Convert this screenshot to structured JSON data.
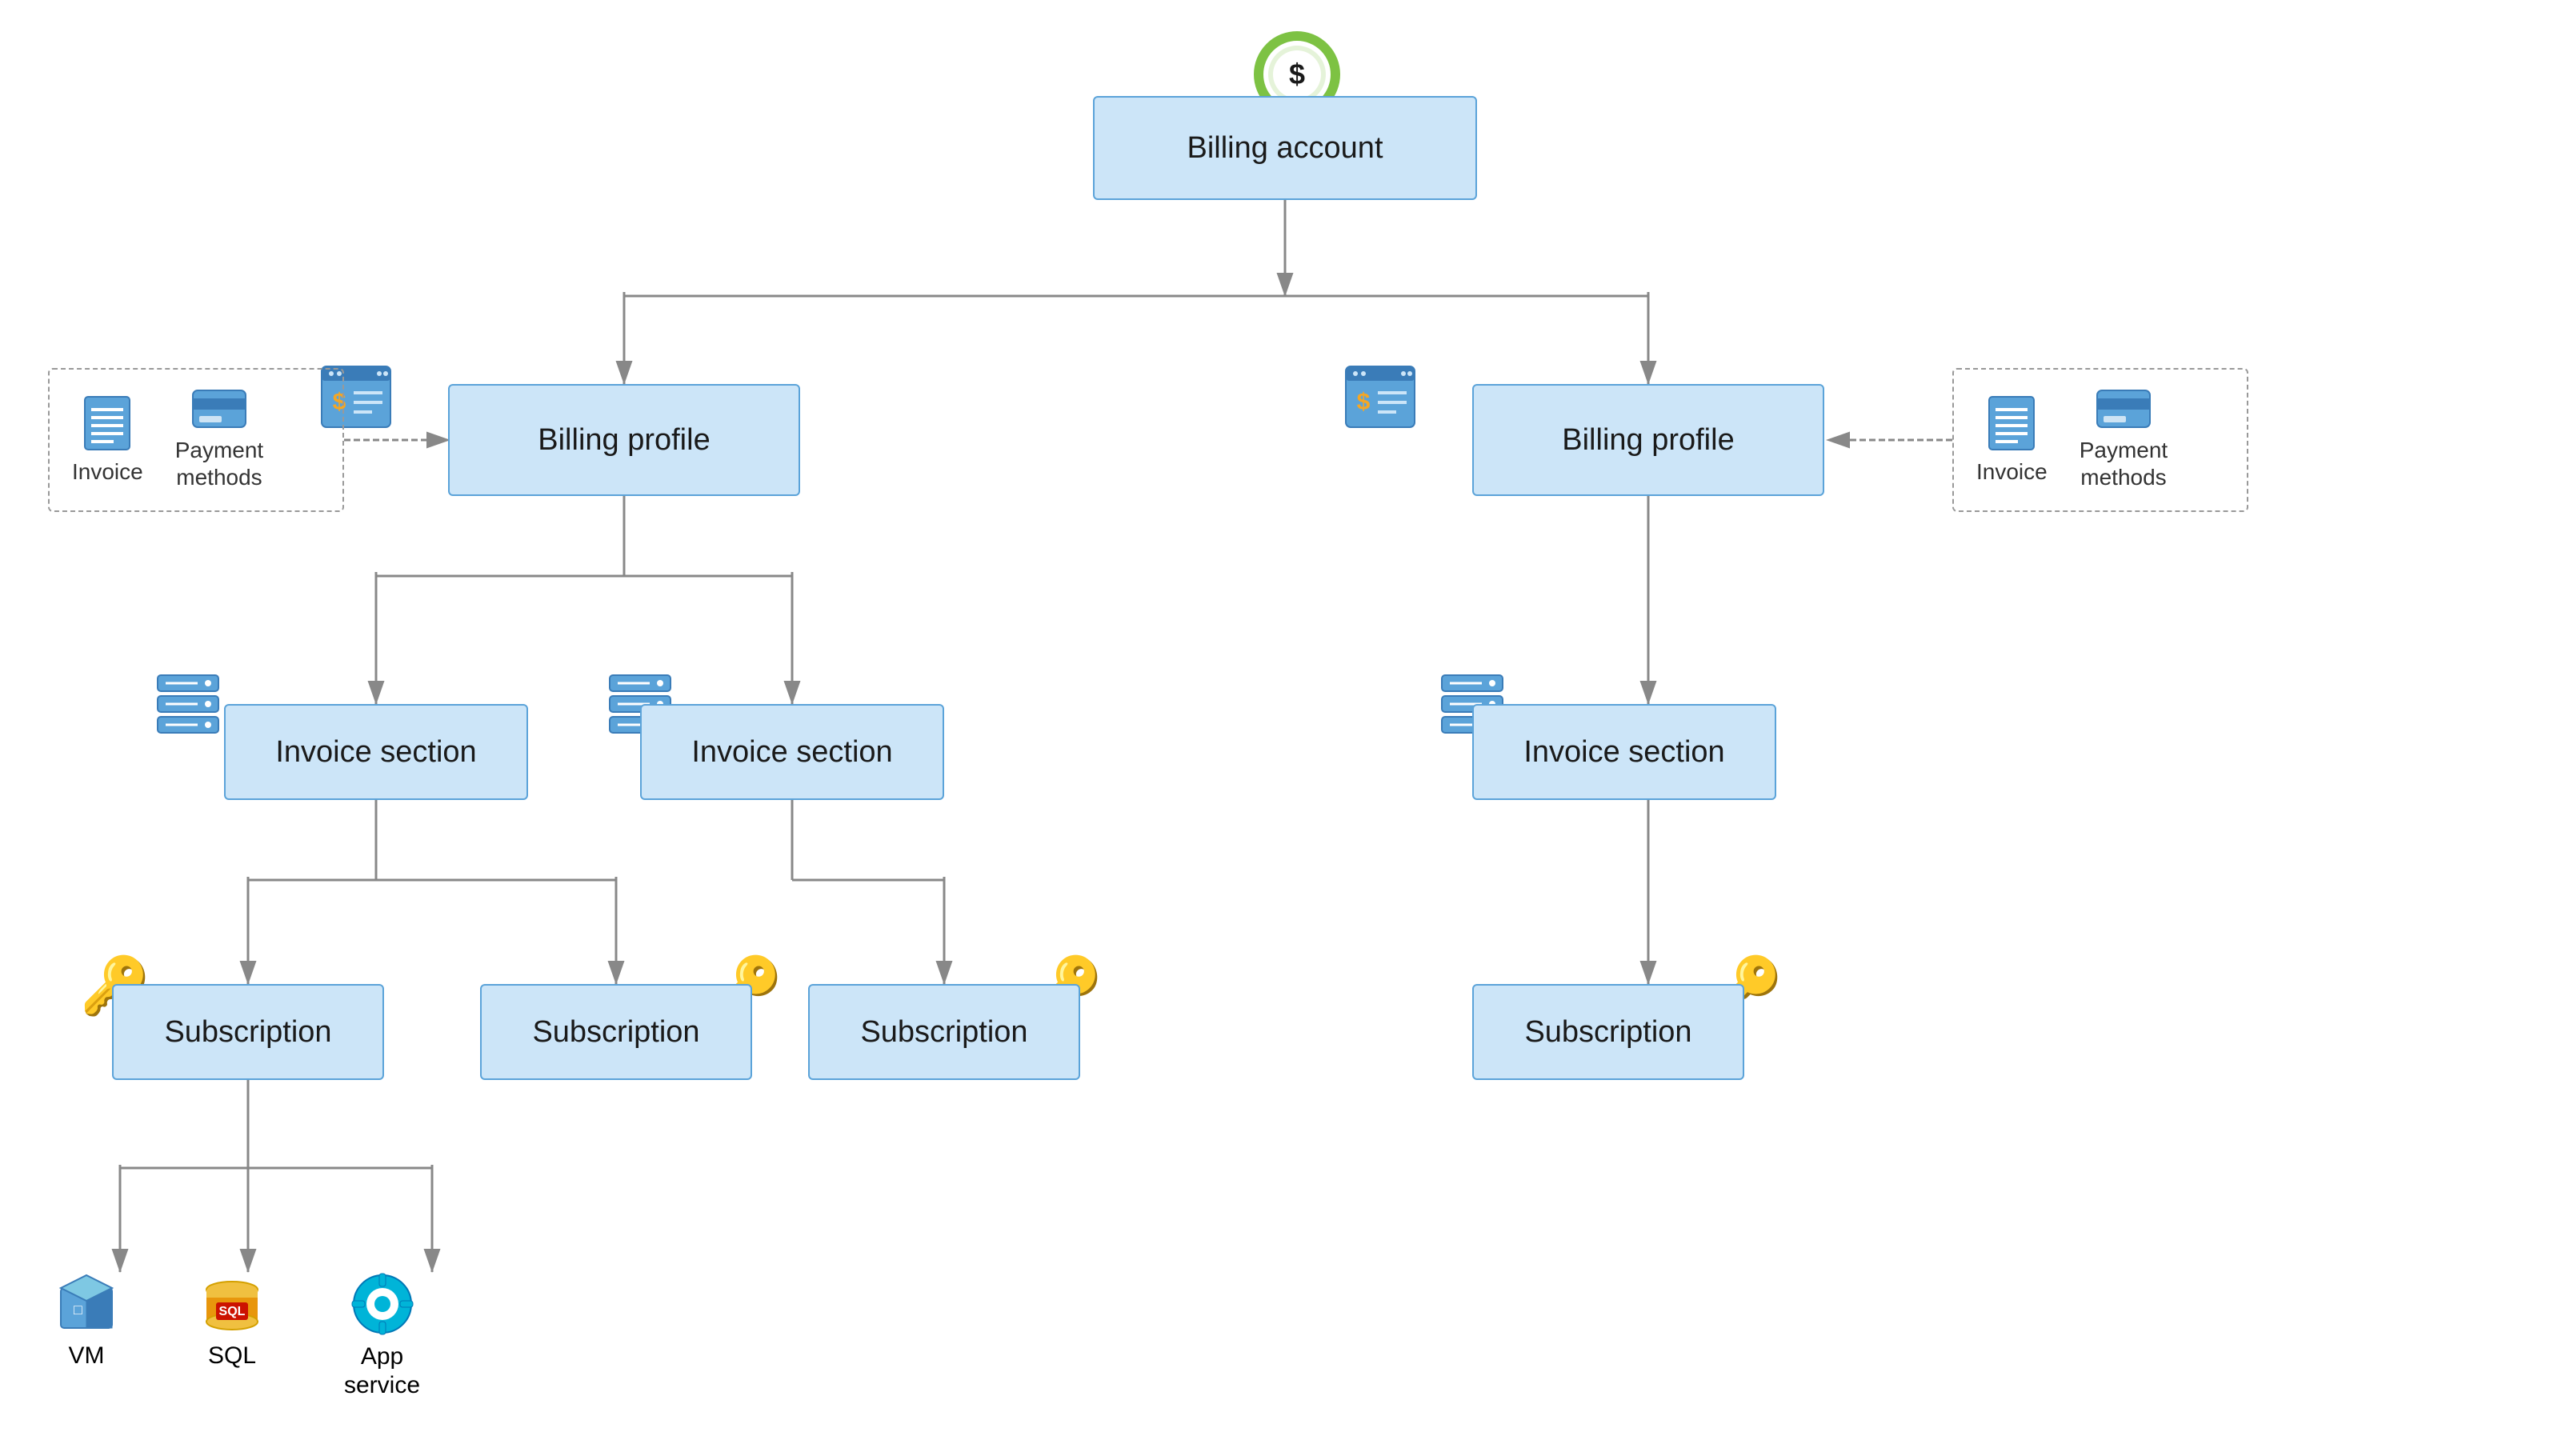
{
  "nodes": {
    "billing_account": {
      "label": "Billing account"
    },
    "billing_profile_left": {
      "label": "Billing profile"
    },
    "billing_profile_right": {
      "label": "Billing profile"
    },
    "invoice_section_1": {
      "label": "Invoice section"
    },
    "invoice_section_2": {
      "label": "Invoice section"
    },
    "invoice_section_3": {
      "label": "Invoice section"
    },
    "subscription_1": {
      "label": "Subscription"
    },
    "subscription_2": {
      "label": "Subscription"
    },
    "subscription_3": {
      "label": "Subscription"
    },
    "subscription_4": {
      "label": "Subscription"
    }
  },
  "dashed_boxes": {
    "left": {
      "item1": {
        "label": "Invoice"
      },
      "item2": {
        "label": "Payment\nmethods"
      }
    },
    "right": {
      "item1": {
        "label": "Invoice"
      },
      "item2": {
        "label": "Payment\nmethods"
      }
    }
  },
  "resources": {
    "vm": {
      "label": "VM"
    },
    "sql": {
      "label": "SQL"
    },
    "app_service": {
      "label": "App\nservice"
    }
  },
  "colors": {
    "node_bg": "#cce5f8",
    "node_border": "#5ba3d9",
    "line_color": "#888",
    "dashed_border": "#999",
    "green_ring": "#7dc243",
    "dollar_yellow": "#f5a623",
    "key_gold": "#f0c040"
  }
}
